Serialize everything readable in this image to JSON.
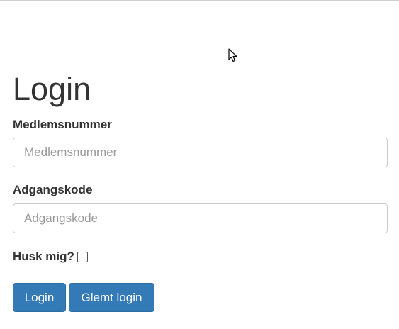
{
  "page": {
    "title": "Login"
  },
  "form": {
    "member_label": "Medlemsnummer",
    "member_placeholder": "Medlemsnummer",
    "member_value": "",
    "password_label": "Adgangskode",
    "password_placeholder": "Adgangskode",
    "password_value": "",
    "remember_label": "Husk mig?",
    "remember_checked": false
  },
  "buttons": {
    "login_label": "Login",
    "forgot_label": "Glemt login"
  },
  "colors": {
    "primary": "#337ab7",
    "primary_border": "#2e6da4",
    "text": "#333333",
    "placeholder": "#999999",
    "input_border": "#cccccc"
  },
  "icons": {
    "cursor": "mouse-pointer-icon",
    "checkbox": "checkbox-unchecked"
  }
}
